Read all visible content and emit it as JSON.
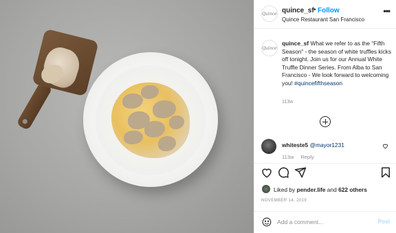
{
  "header": {
    "username": "quince_sf",
    "separator": "•",
    "follow_label": "Follow",
    "location": "Quince Restaurant San Francisco",
    "more_label": "•••",
    "avatar_text": "Quince"
  },
  "caption": {
    "username": "quince_sf",
    "text": "What we refer to as the “Fifth Season” - the season of white truffles kicks off tonight. Join us for our Annual White Truffle Dinner Series. From Alba to San Francisco - We look forward to welcoming you!",
    "hashtag": "#quincefifthseason",
    "time": "113w"
  },
  "comment": {
    "username": "whiteste5",
    "mention": "@mayor1231",
    "time": "113w",
    "reply_label": "Reply"
  },
  "likes": {
    "prefix": "Liked by",
    "user": "pender.life",
    "joiner": "and",
    "others": "622 others"
  },
  "post_date": "NOVEMBER 14, 2019",
  "add_comment": {
    "placeholder": "Add a comment...",
    "post_label": "Post"
  },
  "icons": [
    "ellipsis-icon",
    "plus-circle-icon",
    "heart-icon",
    "comment-icon",
    "share-icon",
    "bookmark-icon",
    "emoji-icon"
  ],
  "colors": {
    "link_blue": "#0095f6",
    "hashtag_blue": "#00376b",
    "muted_gray": "#8e8e8e",
    "post_disabled": "#b2dffc"
  }
}
